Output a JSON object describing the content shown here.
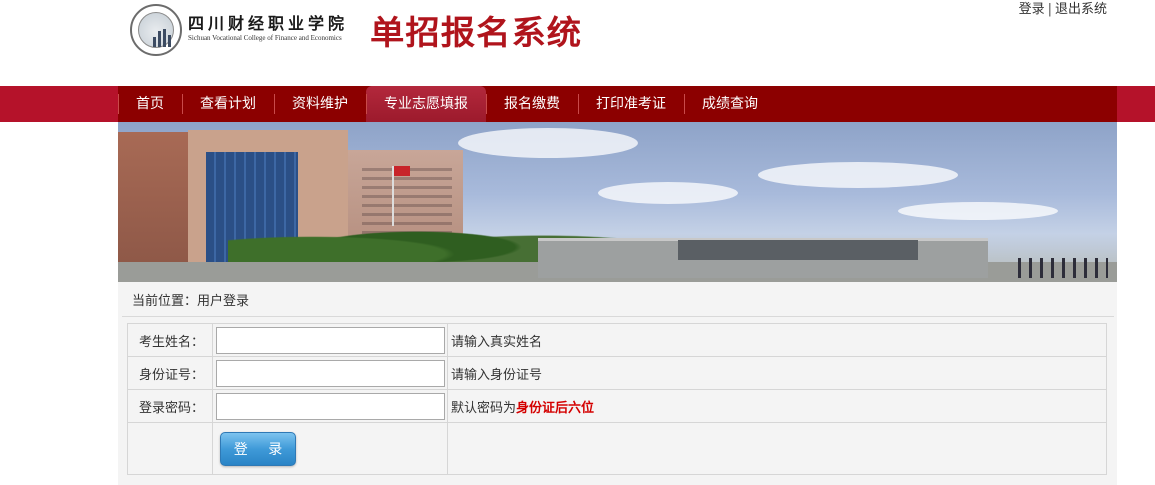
{
  "header": {
    "college_name_cn": "四川财经职业学院",
    "college_name_en": "Sichuan Vocational College of Finance and Economics",
    "system_title": "单招报名系统",
    "login_link": "登录",
    "separator": "|",
    "logout_link": "退出系统"
  },
  "nav": {
    "items": [
      {
        "label": "首页"
      },
      {
        "label": "查看计划"
      },
      {
        "label": "资料维护"
      },
      {
        "label": "专业志愿填报",
        "active": true
      },
      {
        "label": "报名缴费"
      },
      {
        "label": "打印准考证"
      },
      {
        "label": "成绩查询"
      }
    ]
  },
  "breadcrumb": {
    "text": "当前位置：用户登录"
  },
  "form": {
    "rows": [
      {
        "label": "考生姓名：",
        "value": "",
        "hint": "请输入真实姓名"
      },
      {
        "label": "身份证号：",
        "value": "",
        "hint": "请输入身份证号"
      },
      {
        "label": "登录密码：",
        "value": "",
        "hint_prefix": "默认密码为",
        "hint_strong": "身份证后六位"
      }
    ],
    "login_button": "登 录"
  },
  "colors": {
    "brand_red": "#b0141c",
    "nav_bg": "#8c0000",
    "nav_edge": "#b5122a",
    "hint_red": "#d40000",
    "button_blue": "#3f9ad8"
  }
}
